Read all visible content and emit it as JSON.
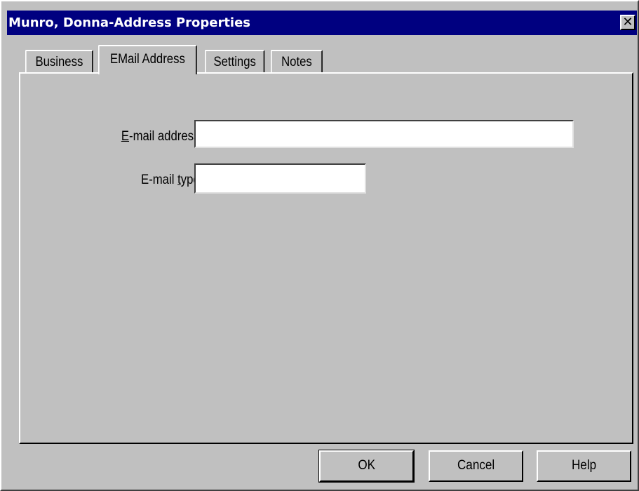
{
  "window": {
    "title": "Munro, Donna-Address Properties",
    "close_glyph": "✕"
  },
  "tabs": [
    {
      "label": "Business",
      "active": false
    },
    {
      "label": "EMail Address",
      "active": true
    },
    {
      "label": "Settings",
      "active": false
    },
    {
      "label": "Notes",
      "active": false
    }
  ],
  "form": {
    "email_address": {
      "label_mnemonic": "E",
      "label_rest": "-mail address:",
      "value": ""
    },
    "email_type": {
      "label_pre": "E-mail ",
      "label_mnemonic": "t",
      "label_rest": "ype:",
      "value": ""
    }
  },
  "buttons": {
    "ok": "OK",
    "cancel": "Cancel",
    "help": "Help"
  },
  "colors": {
    "titlebar": "#000080",
    "face": "#c0c0c0"
  }
}
